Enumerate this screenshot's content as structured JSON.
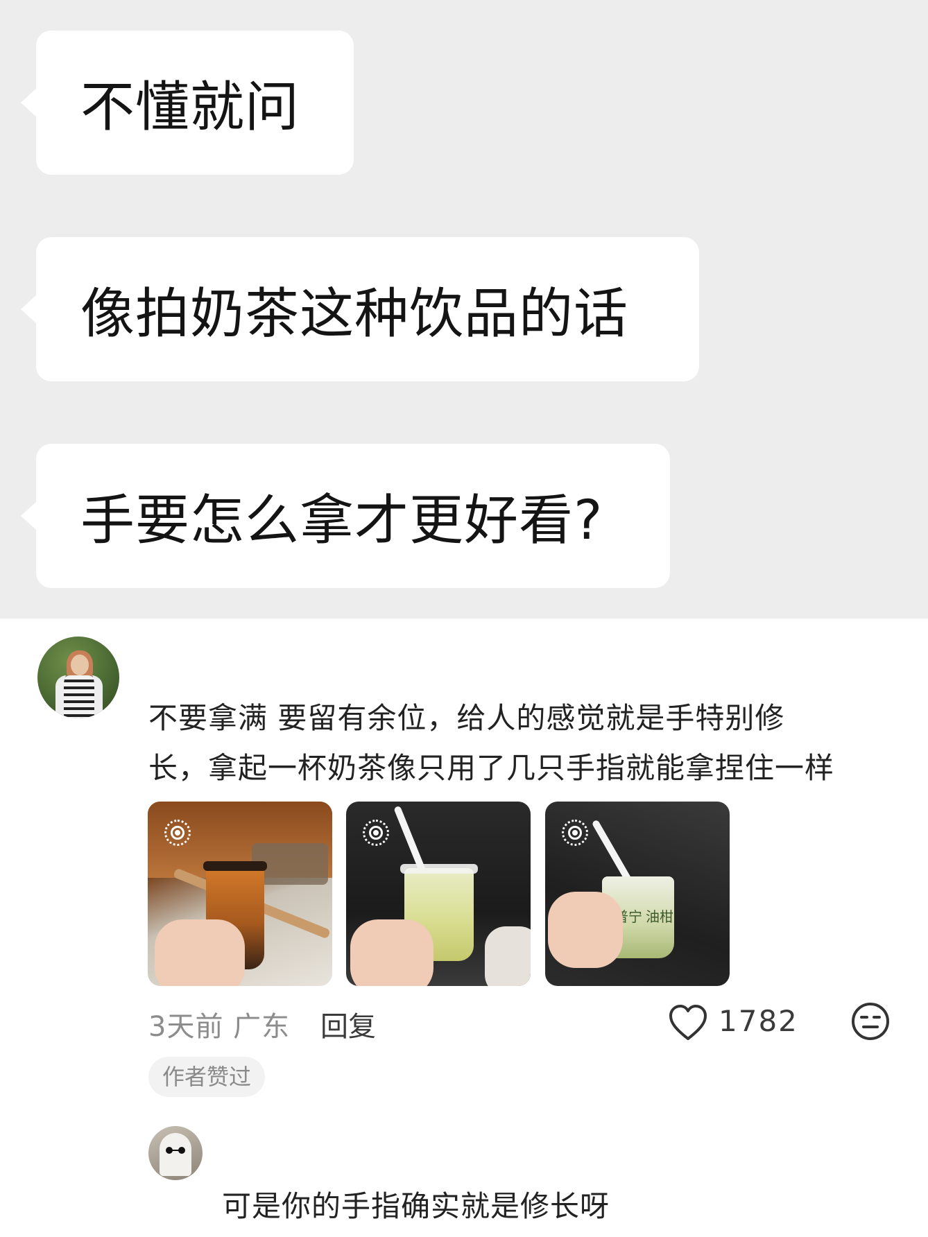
{
  "messages": [
    {
      "text": "不懂就问"
    },
    {
      "text": "像拍奶茶这种饮品的话"
    },
    {
      "text": "手要怎么拿才更好看?"
    }
  ],
  "comment": {
    "line1": "不要拿满 要留有余位，给人的感觉就是手特别修",
    "line2": "长，拿起一杯奶茶像只用了几只手指就能拿捏住一样",
    "images": [
      {
        "icon": "live-photo-icon"
      },
      {
        "icon": "live-photo-icon"
      },
      {
        "icon": "live-photo-icon",
        "printed_text": "普宁 油柑"
      }
    ],
    "time_location": "3天前 广东",
    "reply_label": "回复",
    "likes": "1782",
    "badge": "作者赞过"
  },
  "sub_comment": {
    "text": "可是你的手指确实就是修长呀"
  },
  "icons": [
    "heart-icon",
    "emoji-icon",
    "live-photo-icon"
  ]
}
